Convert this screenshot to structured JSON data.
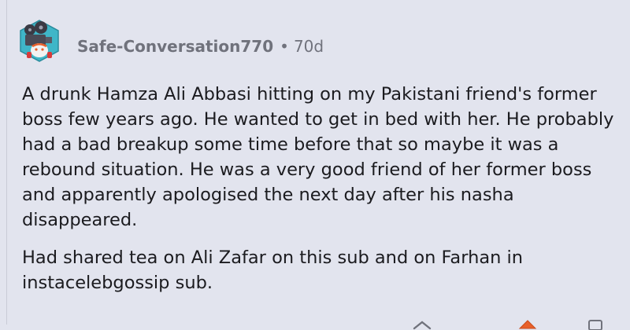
{
  "comment": {
    "author": "Safe-Conversation770",
    "separator": "•",
    "age": "70d",
    "paragraphs": [
      "A drunk Hamza Ali Abbasi hitting on my Pakistani friend's former boss few years ago. He wanted to get in bed with her. He probably had a bad breakup some time before that so maybe it was a rebound situation. He was a very good friend of her former boss and apparently apologised the next day after his nasha disappeared.",
      "Had shared tea on Ali Zafar on this sub and on Farhan in instacelebgossip sub."
    ]
  },
  "icons": {
    "avatar": "snoo-avatar-icon",
    "reply": "reply-arrow-icon",
    "upvote": "upvote-icon",
    "more": "more-options-icon"
  },
  "colors": {
    "background": "#e2e4ee",
    "meta_text": "#70727c",
    "body_text": "#1b1b1f",
    "upvote_accent": "#e8602a"
  }
}
